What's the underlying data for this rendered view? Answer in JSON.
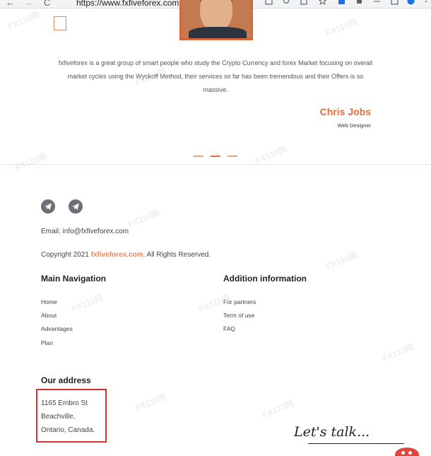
{
  "browser": {
    "url": "https://www.fxfiveforex.com",
    "back_glyph": "←",
    "forward_glyph": "→",
    "reload_glyph": "C"
  },
  "testimonial": {
    "quote": "fxfiveforex is a great group of smart people who study the Crypto Currency and forex Market focusing on overall market cycles using the Wyckoff Method, their services so far has been tremendous and their Offers is so massive.",
    "author_name": "Chris Jobs",
    "author_role": "Web Designer"
  },
  "footer": {
    "social_icons": [
      "telegram-icon",
      "telegram-icon"
    ],
    "email": "Email: info@fxfiveforex.com",
    "copyright_prefix": "Copyright 2021 ",
    "copyright_brand": "fxfiveforex.com",
    "copyright_suffix": ". All Rights Reserved.",
    "main_navigation": {
      "title": "Main Navigation",
      "links": [
        "Home",
        "About",
        "Advantages",
        "Plan"
      ]
    },
    "addition_information": {
      "title": "Addition information",
      "links": [
        "For partners",
        "Term of use",
        "FAQ"
      ]
    },
    "address": {
      "title": "Our address",
      "lines": [
        "1165 Embro St",
        "Beachville,",
        "Ontario, Canada."
      ]
    },
    "lets_talk": "Let's talk..."
  },
  "watermark": "FX110网",
  "colors": {
    "accent": "#e06d43",
    "highlight_box": "#d6322b",
    "brand_link": "#e9875f"
  }
}
